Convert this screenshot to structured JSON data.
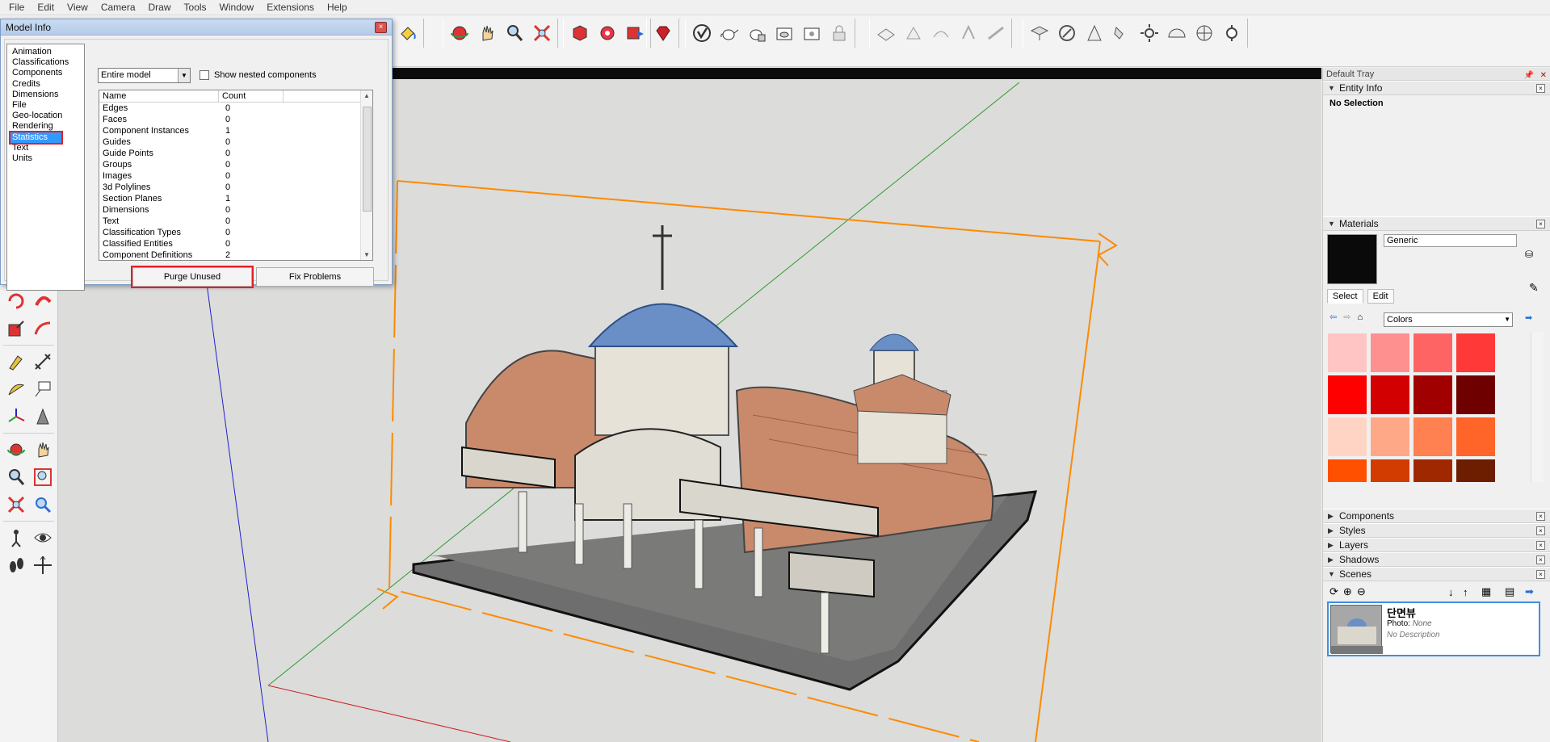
{
  "menu": [
    "File",
    "Edit",
    "View",
    "Camera",
    "Draw",
    "Tools",
    "Window",
    "Extensions",
    "Help"
  ],
  "dialog": {
    "title": "Model Info",
    "close": "×",
    "categories": [
      "Animation",
      "Classifications",
      "Components",
      "Credits",
      "Dimensions",
      "File",
      "Geo-location",
      "Rendering",
      "Statistics",
      "Text",
      "Units"
    ],
    "selected_category": "Statistics",
    "scope_select": "Entire model",
    "nested_label": "Show nested components",
    "nested_checked": false,
    "col_name": "Name",
    "col_count": "Count",
    "rows": [
      {
        "name": "Edges",
        "count": "0"
      },
      {
        "name": "Faces",
        "count": "0"
      },
      {
        "name": "Component Instances",
        "count": "1"
      },
      {
        "name": "Guides",
        "count": "0"
      },
      {
        "name": "Guide Points",
        "count": "0"
      },
      {
        "name": "Groups",
        "count": "0"
      },
      {
        "name": "Images",
        "count": "0"
      },
      {
        "name": "3d Polylines",
        "count": "0"
      },
      {
        "name": "Section Planes",
        "count": "1"
      },
      {
        "name": "Dimensions",
        "count": "0"
      },
      {
        "name": "Text",
        "count": "0"
      },
      {
        "name": "Classification Types",
        "count": "0"
      },
      {
        "name": "Classified Entities",
        "count": "0"
      },
      {
        "name": "Component Definitions",
        "count": "2"
      }
    ],
    "purge_label": "Purge Unused",
    "fix_label": "Fix Problems"
  },
  "tray": {
    "title": "Default Tray",
    "entity_info": {
      "title": "Entity Info",
      "selection": "No Selection"
    },
    "materials": {
      "title": "Materials",
      "name": "Generic",
      "tab_select": "Select",
      "tab_edit": "Edit",
      "library": "Colors",
      "preview_color": "#0a0a0a",
      "swatches": [
        "#ffc4c4",
        "#ff9090",
        "#ff6464",
        "#ff3838",
        "#ff0000",
        "#d20000",
        "#a00000",
        "#6e0000",
        "#ffd4c4",
        "#ffa888",
        "#ff8050",
        "#ff6428",
        "#ff5000",
        "#d23c00",
        "#a02800",
        "#6e1e00"
      ]
    },
    "collapsed_panels": [
      "Components",
      "Styles",
      "Layers",
      "Shadows"
    ],
    "scenes": {
      "title": "Scenes",
      "scene_name": "단면뷰",
      "photo_label": "Photo:",
      "photo_value": "None",
      "description": "No Description"
    }
  },
  "left_tools": [
    "rotate-icon",
    "follow-me-icon",
    "scale-icon",
    "offset-icon",
    "tape-measure-icon",
    "dimension-icon",
    "protractor-icon",
    "text-tool-icon",
    "axes-icon",
    "3d-text-icon",
    "orbit-icon",
    "pan-icon",
    "zoom-icon",
    "zoom-window-icon",
    "zoom-extents-icon",
    "previous-view-icon",
    "position-camera-icon",
    "look-around-icon",
    "walk-icon",
    "section-plane-icon"
  ]
}
